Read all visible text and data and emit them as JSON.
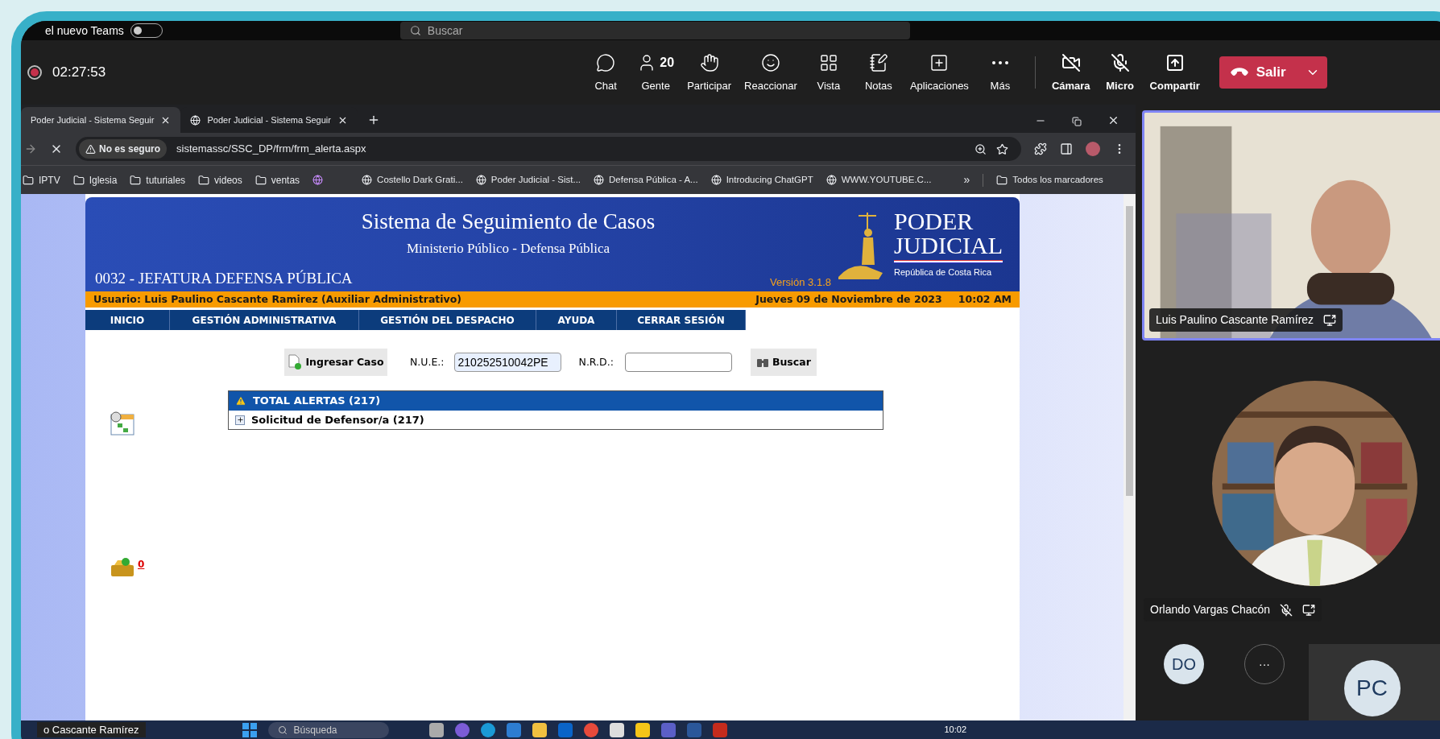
{
  "top_bar": {
    "label": "el nuevo Teams",
    "toggle_on": false,
    "search": {
      "placeholder": "Buscar"
    }
  },
  "meeting": {
    "recording": true,
    "timer": "02:27:53",
    "actions": [
      {
        "kind": "chat",
        "label": "Chat"
      },
      {
        "kind": "people",
        "label": "Gente",
        "count": "20"
      },
      {
        "kind": "raise",
        "label": "Participar"
      },
      {
        "kind": "react",
        "label": "Reaccionar"
      },
      {
        "kind": "view",
        "label": "Vista"
      },
      {
        "kind": "notes",
        "label": "Notas"
      },
      {
        "kind": "apps",
        "label": "Aplicaciones"
      },
      {
        "kind": "more",
        "label": "Más"
      }
    ],
    "devices": [
      {
        "kind": "camera",
        "label": "Cámara",
        "off": true
      },
      {
        "kind": "mic",
        "label": "Micro",
        "off": true
      },
      {
        "kind": "share",
        "label": "Compartir"
      }
    ],
    "leave": "Salir"
  },
  "browser": {
    "tabs": [
      {
        "title": "Poder Judicial - Sistema Seguir",
        "selected": true
      },
      {
        "title": "Poder Judicial - Sistema Seguir",
        "selected": false
      }
    ],
    "security": "No es seguro",
    "url": "sistemassc/SSC_DP/frm/frm_alerta.aspx",
    "bookmarks": [
      {
        "kind": "folder",
        "label": "IPTV"
      },
      {
        "kind": "folder",
        "label": "Iglesia"
      },
      {
        "kind": "folder",
        "label": "tuturiales"
      },
      {
        "kind": "folder",
        "label": "videos"
      },
      {
        "kind": "folder",
        "label": "ventas"
      },
      {
        "kind": "site"
      },
      {
        "kind": "site",
        "label": "Costello Dark Grati..."
      },
      {
        "kind": "site",
        "label": "Poder Judicial - Sist..."
      },
      {
        "kind": "site",
        "label": "Defensa Pública - A..."
      },
      {
        "kind": "site",
        "label": "Introducing ChatGPT"
      },
      {
        "kind": "site",
        "label": "WWW.YOUTUBE.C..."
      }
    ],
    "more": "»",
    "all_bookmarks": "Todos los marcadores"
  },
  "page": {
    "title": "Sistema de Seguimiento de Casos",
    "subtitle": "Ministerio Público - Defensa Pública",
    "office": "0032 - JEFATURA DEFENSA PÚBLICA",
    "version": "Versión 3.1.8",
    "logo": {
      "line_1": "PODER",
      "line_2": "JUDICIAL",
      "country": "República de Costa Rica"
    },
    "user": "Usuario: Luis Paulino Cascante Ramirez (Auxiliar Administrativo)",
    "date": "Jueves 09 de Noviembre de 2023",
    "time": "10:02 AM",
    "menu": [
      "INICIO",
      "GESTIÓN ADMINISTRATIVA",
      "GESTIÓN DEL DESPACHO",
      "AYUDA",
      "CERRAR SESIÓN"
    ],
    "new_case": "Ingresar Caso",
    "nue_label": "N.U.E.:",
    "nue_value": "210252510042PE",
    "nrd_label": "N.R.D.:",
    "search": "Buscar",
    "alerts": {
      "title": "TOTAL ALERTAS (217)",
      "rows": [
        {
          "label": "Solicitud de Defensor/a (217)",
          "expanded": false
        }
      ]
    },
    "inbox_count": "0"
  },
  "participants": [
    {
      "kind": "video",
      "name": "Luis Paulino Cascante Ramírez",
      "speaking": true,
      "muted": false
    },
    {
      "kind": "round_video",
      "name": "Orlando Vargas Chacón",
      "speaking": false,
      "muted": true
    }
  ],
  "avatars": [
    {
      "kind": "initials",
      "text": "DO"
    },
    {
      "kind": "more",
      "text": "···"
    },
    {
      "kind": "tile",
      "text": "PC"
    }
  ],
  "taskbar": {
    "presenter": "o Cascante Ramírez",
    "search": "Búsqueda",
    "clock": "10:02"
  }
}
